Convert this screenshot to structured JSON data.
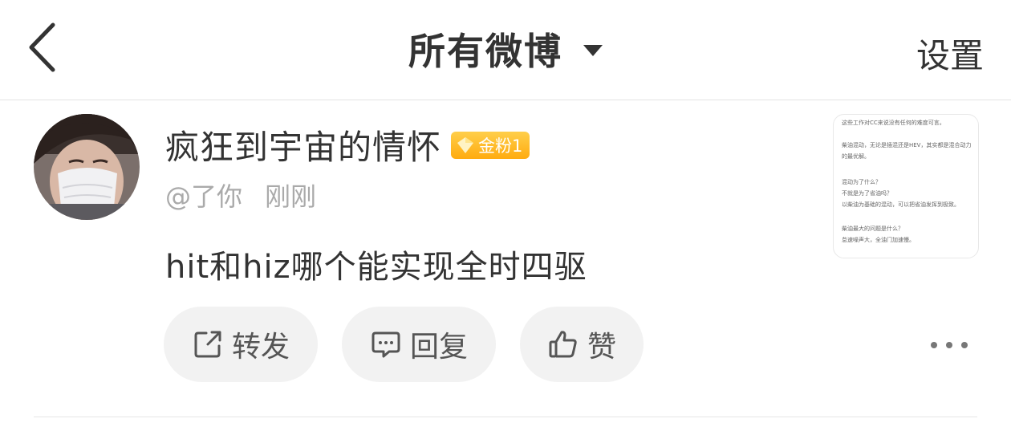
{
  "header": {
    "title": "所有微博",
    "settings_label": "设置"
  },
  "post": {
    "username": "疯狂到宇宙的情怀",
    "badge": "金粉1",
    "handle": "@了你",
    "time": "刚刚",
    "text": "hit和hiz哪个能实现全时四驱",
    "image_lines": [
      "这些工作对CC来说没有任何的难度可言。",
      "柴油混动，无论是插混还是HEV，其实都是混合动力",
      "的最优解。",
      "混动为了什么？",
      "不就是为了省油吗？",
      "以柴油为基础的混动，可以把省油发挥到极致。",
      "柴油最大的问题是什么？",
      "怠速噪声大，全油门加速慢。"
    ]
  },
  "actions": {
    "repost_label": "转发",
    "comment_label": "回复",
    "like_label": "赞"
  },
  "colors": {
    "badge_gold": "#ffb321",
    "text_primary": "#333333",
    "text_secondary": "#aaaaaa",
    "button_bg": "#f2f2f2"
  },
  "icons": {
    "back": "chevron-left-icon",
    "dropdown": "caret-down-icon",
    "repost": "share-icon",
    "comment": "comment-icon",
    "like": "thumbs-up-icon",
    "more": "more-dots-icon"
  }
}
